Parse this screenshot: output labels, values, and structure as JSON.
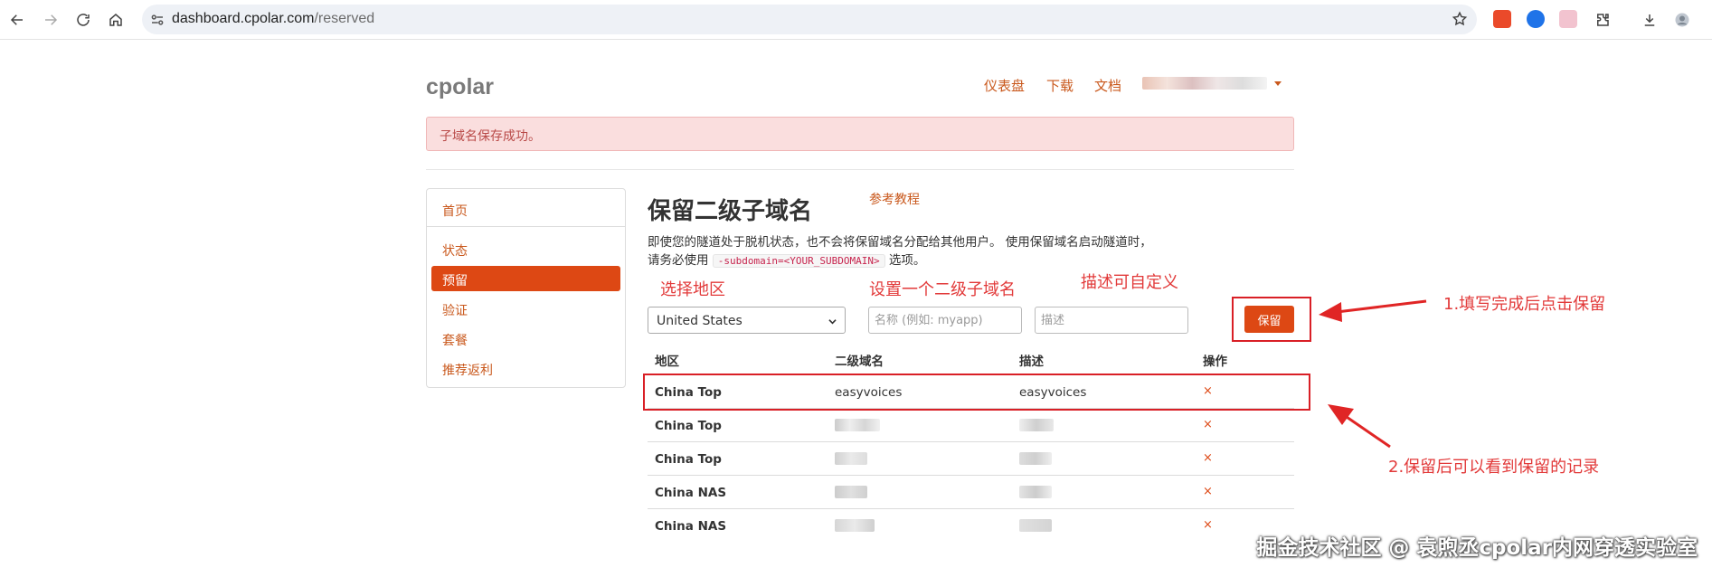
{
  "browser": {
    "url_host": "dashboard.cpolar.com",
    "url_path": "/reserved"
  },
  "site": {
    "brand": "cpolar",
    "nav": [
      "仪表盘",
      "下载",
      "文档"
    ]
  },
  "alert": "子域名保存成功。",
  "sidebar": {
    "items": [
      {
        "label": "首页",
        "active": false
      },
      {
        "label": "状态",
        "active": false
      },
      {
        "label": "预留",
        "active": true
      },
      {
        "label": "验证",
        "active": false
      },
      {
        "label": "套餐",
        "active": false
      },
      {
        "label": "推荐返利",
        "active": false
      }
    ]
  },
  "main": {
    "title": "保留二级子域名",
    "tutorial_link": "参考教程",
    "desc_part1": "即使您的隧道处于脱机状态，也不会将保留域名分配给其他用户。 使用保留域名启动隧道时，请务必使用",
    "desc_code": "-subdomain=<YOUR_SUBDOMAIN>",
    "desc_part2": "选项。",
    "form": {
      "region_value": "United States",
      "name_placeholder": "名称 (例如: myapp)",
      "desc_placeholder": "描述",
      "save_label": "保留"
    },
    "table": {
      "headers": [
        "地区",
        "二级域名",
        "描述",
        "操作"
      ],
      "rows": [
        {
          "region": "China Top",
          "subdomain": "easyvoices",
          "description": "easyvoices",
          "action": "×"
        },
        {
          "region": "China Top",
          "subdomain": "",
          "description": "",
          "action": "×"
        },
        {
          "region": "China Top",
          "subdomain": "",
          "description": "",
          "action": "×"
        },
        {
          "region": "China NAS",
          "subdomain": "",
          "description": "",
          "action": "×"
        },
        {
          "region": "China NAS",
          "subdomain": "",
          "description": "",
          "action": "×"
        }
      ]
    }
  },
  "annotations": {
    "select_region": "选择地区",
    "set_subdomain": "设置一个二级子域名",
    "custom_desc": "描述可自定义",
    "step1": "1.填写完成后点击保留",
    "step2": "2.保留后可以看到保留的记录"
  },
  "watermark": "掘金技术社区 @ 袁煦丞cpolar内网穿透实验室",
  "colors": {
    "accent": "#dd4814",
    "link": "#c9581c",
    "annotation_red": "#d91f26",
    "alert_bg": "#fadede"
  }
}
